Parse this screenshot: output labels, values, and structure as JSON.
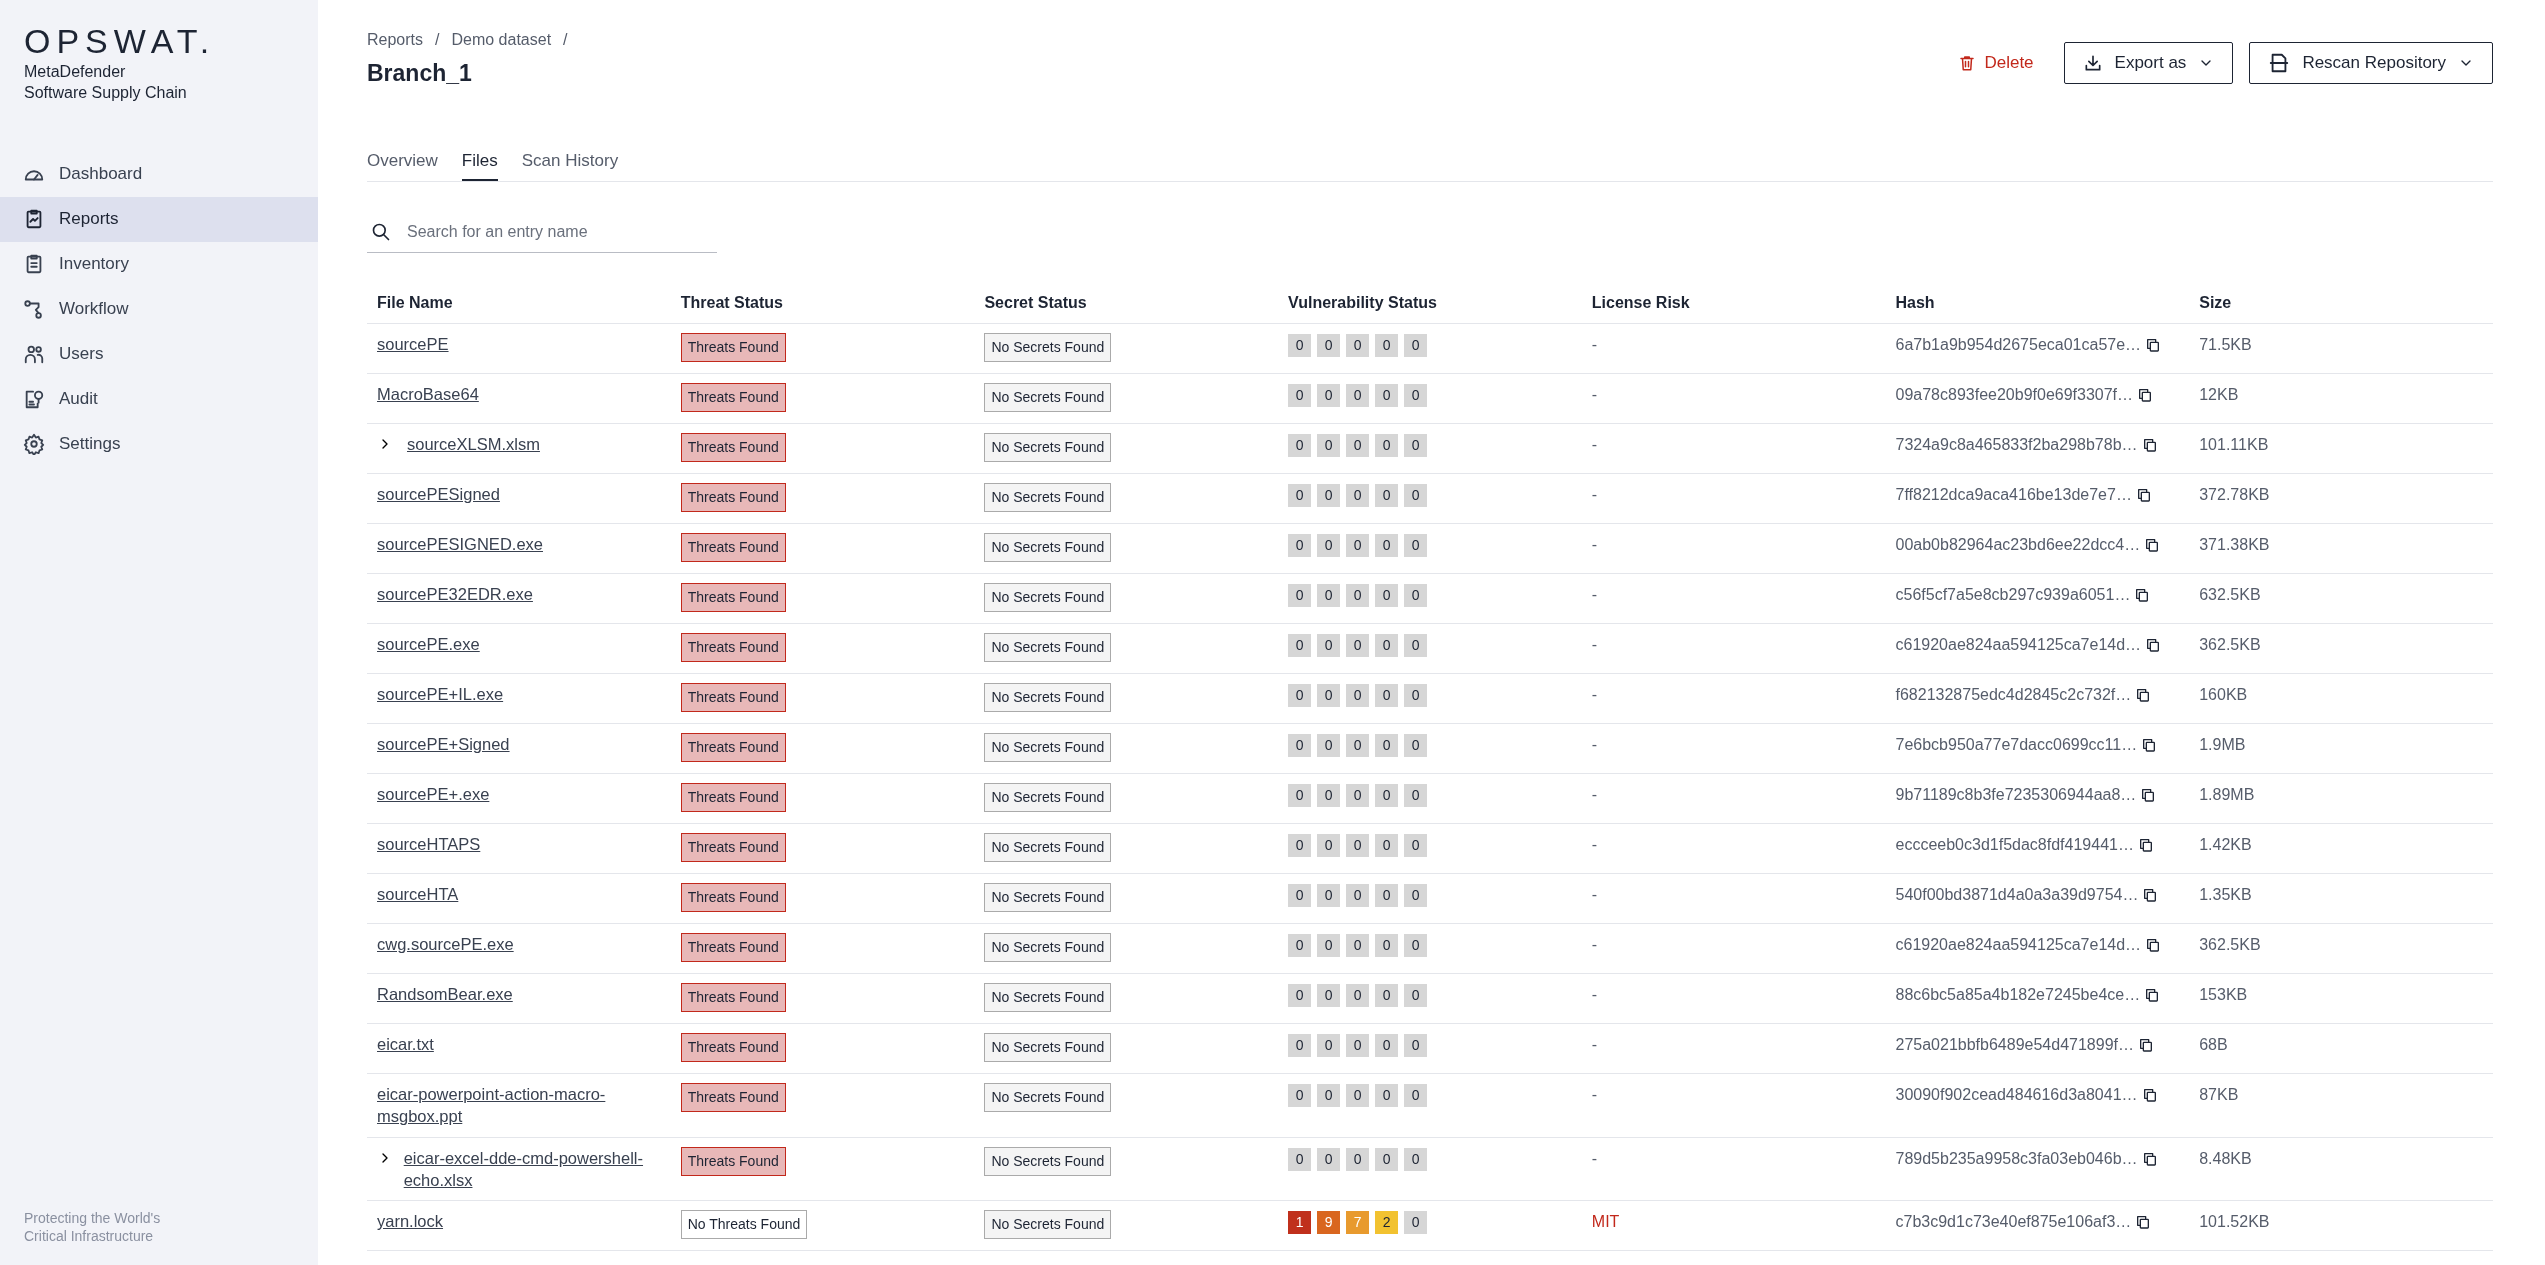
{
  "brand": {
    "logo": "OPSWAT.",
    "product_line1": "MetaDefender",
    "product_line2": "Software Supply Chain",
    "tagline": "Protecting the World's Critical Infrastructure"
  },
  "sidebar": {
    "items": [
      {
        "label": "Dashboard",
        "selected": false
      },
      {
        "label": "Reports",
        "selected": true
      },
      {
        "label": "Inventory",
        "selected": false
      },
      {
        "label": "Workflow",
        "selected": false
      },
      {
        "label": "Users",
        "selected": false
      },
      {
        "label": "Audit",
        "selected": false
      },
      {
        "label": "Settings",
        "selected": false
      }
    ]
  },
  "breadcrumb": [
    {
      "label": "Reports",
      "separator": "/"
    },
    {
      "label": "Demo dataset",
      "separator": "/"
    }
  ],
  "title": "Branch_1",
  "actions": {
    "delete": "Delete",
    "export": "Export as",
    "rescan": "Rescan Repository"
  },
  "tabs": [
    {
      "label": "Overview",
      "selected": false
    },
    {
      "label": "Files",
      "selected": true
    },
    {
      "label": "Scan History",
      "selected": false
    }
  ],
  "search": {
    "placeholder": "Search for an entry name"
  },
  "table": {
    "columns": [
      "File Name",
      "Threat Status",
      "Secret Status",
      "Vulnerability Status",
      "License Risk",
      "Hash",
      "Size"
    ],
    "rows": [
      {
        "name": "sourcePE",
        "threat": {
          "text": "Threats Found",
          "found": true
        },
        "secret": "No Secrets Found",
        "vulns": [
          {
            "count": "0",
            "color": "#d6d6d6"
          },
          {
            "count": "0",
            "color": "#d6d6d6"
          },
          {
            "count": "0",
            "color": "#d6d6d6"
          },
          {
            "count": "0",
            "color": "#d6d6d6"
          },
          {
            "count": "0",
            "color": "#d6d6d6"
          }
        ],
        "license": {
          "text": "-",
          "flagged": false
        },
        "hash": "6a7b1a9b954d2675eca01ca57e…",
        "size": "71.5KB"
      },
      {
        "name": "MacroBase64",
        "threat": {
          "text": "Threats Found",
          "found": true
        },
        "secret": "No Secrets Found",
        "vulns": [
          {
            "count": "0",
            "color": "#d6d6d6"
          },
          {
            "count": "0",
            "color": "#d6d6d6"
          },
          {
            "count": "0",
            "color": "#d6d6d6"
          },
          {
            "count": "0",
            "color": "#d6d6d6"
          },
          {
            "count": "0",
            "color": "#d6d6d6"
          }
        ],
        "license": {
          "text": "-",
          "flagged": false
        },
        "hash": "09a78c893fee20b9f0e69f3307f…",
        "size": "12KB"
      },
      {
        "name": "sourceXLSM.xlsm",
        "expanded": false,
        "threat": {
          "text": "Threats Found",
          "found": true
        },
        "secret": "No Secrets Found",
        "vulns": [
          {
            "count": "0",
            "color": "#d6d6d6"
          },
          {
            "count": "0",
            "color": "#d6d6d6"
          },
          {
            "count": "0",
            "color": "#d6d6d6"
          },
          {
            "count": "0",
            "color": "#d6d6d6"
          },
          {
            "count": "0",
            "color": "#d6d6d6"
          }
        ],
        "license": {
          "text": "-",
          "flagged": false
        },
        "hash": "7324a9c8a465833f2ba298b78b…",
        "size": "101.11KB"
      },
      {
        "name": "sourcePESigned",
        "threat": {
          "text": "Threats Found",
          "found": true
        },
        "secret": "No Secrets Found",
        "vulns": [
          {
            "count": "0",
            "color": "#d6d6d6"
          },
          {
            "count": "0",
            "color": "#d6d6d6"
          },
          {
            "count": "0",
            "color": "#d6d6d6"
          },
          {
            "count": "0",
            "color": "#d6d6d6"
          },
          {
            "count": "0",
            "color": "#d6d6d6"
          }
        ],
        "license": {
          "text": "-",
          "flagged": false
        },
        "hash": "7ff8212dca9aca416be13de7e7…",
        "size": "372.78KB"
      },
      {
        "name": "sourcePESIGNED.exe",
        "threat": {
          "text": "Threats Found",
          "found": true
        },
        "secret": "No Secrets Found",
        "vulns": [
          {
            "count": "0",
            "color": "#d6d6d6"
          },
          {
            "count": "0",
            "color": "#d6d6d6"
          },
          {
            "count": "0",
            "color": "#d6d6d6"
          },
          {
            "count": "0",
            "color": "#d6d6d6"
          },
          {
            "count": "0",
            "color": "#d6d6d6"
          }
        ],
        "license": {
          "text": "-",
          "flagged": false
        },
        "hash": "00ab0b82964ac23bd6ee22dcc4…",
        "size": "371.38KB"
      },
      {
        "name": "sourcePE32EDR.exe",
        "threat": {
          "text": "Threats Found",
          "found": true
        },
        "secret": "No Secrets Found",
        "vulns": [
          {
            "count": "0",
            "color": "#d6d6d6"
          },
          {
            "count": "0",
            "color": "#d6d6d6"
          },
          {
            "count": "0",
            "color": "#d6d6d6"
          },
          {
            "count": "0",
            "color": "#d6d6d6"
          },
          {
            "count": "0",
            "color": "#d6d6d6"
          }
        ],
        "license": {
          "text": "-",
          "flagged": false
        },
        "hash": "c56f5cf7a5e8cb297c939a6051…",
        "size": "632.5KB"
      },
      {
        "name": "sourcePE.exe",
        "threat": {
          "text": "Threats Found",
          "found": true
        },
        "secret": "No Secrets Found",
        "vulns": [
          {
            "count": "0",
            "color": "#d6d6d6"
          },
          {
            "count": "0",
            "color": "#d6d6d6"
          },
          {
            "count": "0",
            "color": "#d6d6d6"
          },
          {
            "count": "0",
            "color": "#d6d6d6"
          },
          {
            "count": "0",
            "color": "#d6d6d6"
          }
        ],
        "license": {
          "text": "-",
          "flagged": false
        },
        "hash": "c61920ae824aa594125ca7e14d…",
        "size": "362.5KB"
      },
      {
        "name": "sourcePE+IL.exe",
        "threat": {
          "text": "Threats Found",
          "found": true
        },
        "secret": "No Secrets Found",
        "vulns": [
          {
            "count": "0",
            "color": "#d6d6d6"
          },
          {
            "count": "0",
            "color": "#d6d6d6"
          },
          {
            "count": "0",
            "color": "#d6d6d6"
          },
          {
            "count": "0",
            "color": "#d6d6d6"
          },
          {
            "count": "0",
            "color": "#d6d6d6"
          }
        ],
        "license": {
          "text": "-",
          "flagged": false
        },
        "hash": "f682132875edc4d2845c2c732f…",
        "size": "160KB"
      },
      {
        "name": "sourcePE+Signed",
        "threat": {
          "text": "Threats Found",
          "found": true
        },
        "secret": "No Secrets Found",
        "vulns": [
          {
            "count": "0",
            "color": "#d6d6d6"
          },
          {
            "count": "0",
            "color": "#d6d6d6"
          },
          {
            "count": "0",
            "color": "#d6d6d6"
          },
          {
            "count": "0",
            "color": "#d6d6d6"
          },
          {
            "count": "0",
            "color": "#d6d6d6"
          }
        ],
        "license": {
          "text": "-",
          "flagged": false
        },
        "hash": "7e6bcb950a77e7dacc0699cc11…",
        "size": "1.9MB"
      },
      {
        "name": "sourcePE+.exe",
        "threat": {
          "text": "Threats Found",
          "found": true
        },
        "secret": "No Secrets Found",
        "vulns": [
          {
            "count": "0",
            "color": "#d6d6d6"
          },
          {
            "count": "0",
            "color": "#d6d6d6"
          },
          {
            "count": "0",
            "color": "#d6d6d6"
          },
          {
            "count": "0",
            "color": "#d6d6d6"
          },
          {
            "count": "0",
            "color": "#d6d6d6"
          }
        ],
        "license": {
          "text": "-",
          "flagged": false
        },
        "hash": "9b71189c8b3fe7235306944aa8…",
        "size": "1.89MB"
      },
      {
        "name": "sourceHTAPS",
        "threat": {
          "text": "Threats Found",
          "found": true
        },
        "secret": "No Secrets Found",
        "vulns": [
          {
            "count": "0",
            "color": "#d6d6d6"
          },
          {
            "count": "0",
            "color": "#d6d6d6"
          },
          {
            "count": "0",
            "color": "#d6d6d6"
          },
          {
            "count": "0",
            "color": "#d6d6d6"
          },
          {
            "count": "0",
            "color": "#d6d6d6"
          }
        ],
        "license": {
          "text": "-",
          "flagged": false
        },
        "hash": "eccceeb0c3d1f5dac8fdf419441…",
        "size": "1.42KB"
      },
      {
        "name": "sourceHTA",
        "threat": {
          "text": "Threats Found",
          "found": true
        },
        "secret": "No Secrets Found",
        "vulns": [
          {
            "count": "0",
            "color": "#d6d6d6"
          },
          {
            "count": "0",
            "color": "#d6d6d6"
          },
          {
            "count": "0",
            "color": "#d6d6d6"
          },
          {
            "count": "0",
            "color": "#d6d6d6"
          },
          {
            "count": "0",
            "color": "#d6d6d6"
          }
        ],
        "license": {
          "text": "-",
          "flagged": false
        },
        "hash": "540f00bd3871d4a0a3a39d9754…",
        "size": "1.35KB"
      },
      {
        "name": "cwg.sourcePE.exe",
        "threat": {
          "text": "Threats Found",
          "found": true
        },
        "secret": "No Secrets Found",
        "vulns": [
          {
            "count": "0",
            "color": "#d6d6d6"
          },
          {
            "count": "0",
            "color": "#d6d6d6"
          },
          {
            "count": "0",
            "color": "#d6d6d6"
          },
          {
            "count": "0",
            "color": "#d6d6d6"
          },
          {
            "count": "0",
            "color": "#d6d6d6"
          }
        ],
        "license": {
          "text": "-",
          "flagged": false
        },
        "hash": "c61920ae824aa594125ca7e14d…",
        "size": "362.5KB"
      },
      {
        "name": "RandsomBear.exe",
        "threat": {
          "text": "Threats Found",
          "found": true
        },
        "secret": "No Secrets Found",
        "vulns": [
          {
            "count": "0",
            "color": "#d6d6d6"
          },
          {
            "count": "0",
            "color": "#d6d6d6"
          },
          {
            "count": "0",
            "color": "#d6d6d6"
          },
          {
            "count": "0",
            "color": "#d6d6d6"
          },
          {
            "count": "0",
            "color": "#d6d6d6"
          }
        ],
        "license": {
          "text": "-",
          "flagged": false
        },
        "hash": "88c6bc5a85a4b182e7245be4ce…",
        "size": "153KB"
      },
      {
        "name": "eicar.txt",
        "threat": {
          "text": "Threats Found",
          "found": true
        },
        "secret": "No Secrets Found",
        "vulns": [
          {
            "count": "0",
            "color": "#d6d6d6"
          },
          {
            "count": "0",
            "color": "#d6d6d6"
          },
          {
            "count": "0",
            "color": "#d6d6d6"
          },
          {
            "count": "0",
            "color": "#d6d6d6"
          },
          {
            "count": "0",
            "color": "#d6d6d6"
          }
        ],
        "license": {
          "text": "-",
          "flagged": false
        },
        "hash": "275a021bbfb6489e54d471899f…",
        "size": "68B"
      },
      {
        "name": "eicar-powerpoint-action-macro-msgbox.ppt",
        "threat": {
          "text": "Threats Found",
          "found": true
        },
        "secret": "No Secrets Found",
        "vulns": [
          {
            "count": "0",
            "color": "#d6d6d6"
          },
          {
            "count": "0",
            "color": "#d6d6d6"
          },
          {
            "count": "0",
            "color": "#d6d6d6"
          },
          {
            "count": "0",
            "color": "#d6d6d6"
          },
          {
            "count": "0",
            "color": "#d6d6d6"
          }
        ],
        "license": {
          "text": "-",
          "flagged": false
        },
        "hash": "30090f902cead484616d3a8041…",
        "size": "87KB"
      },
      {
        "name": "eicar-excel-dde-cmd-powershell-echo.xlsx",
        "expanded": false,
        "threat": {
          "text": "Threats Found",
          "found": true
        },
        "secret": "No Secrets Found",
        "vulns": [
          {
            "count": "0",
            "color": "#d6d6d6"
          },
          {
            "count": "0",
            "color": "#d6d6d6"
          },
          {
            "count": "0",
            "color": "#d6d6d6"
          },
          {
            "count": "0",
            "color": "#d6d6d6"
          },
          {
            "count": "0",
            "color": "#d6d6d6"
          }
        ],
        "license": {
          "text": "-",
          "flagged": false
        },
        "hash": "789d5b235a9958c3fa03eb046b…",
        "size": "8.48KB"
      },
      {
        "name": "yarn.lock",
        "threat": {
          "text": "No Threats Found",
          "found": false
        },
        "secret": "No Secrets Found",
        "vulns": [
          {
            "count": "1",
            "color": "#c0301c"
          },
          {
            "count": "9",
            "color": "#d9661f"
          },
          {
            "count": "7",
            "color": "#e89a2e"
          },
          {
            "count": "2",
            "color": "#f2c230"
          },
          {
            "count": "0",
            "color": "#d6d6d6"
          }
        ],
        "license": {
          "text": "MIT",
          "flagged": true
        },
        "hash": "c7b3c9d1c73e40ef875e106af3…",
        "size": "101.52KB"
      }
    ]
  }
}
